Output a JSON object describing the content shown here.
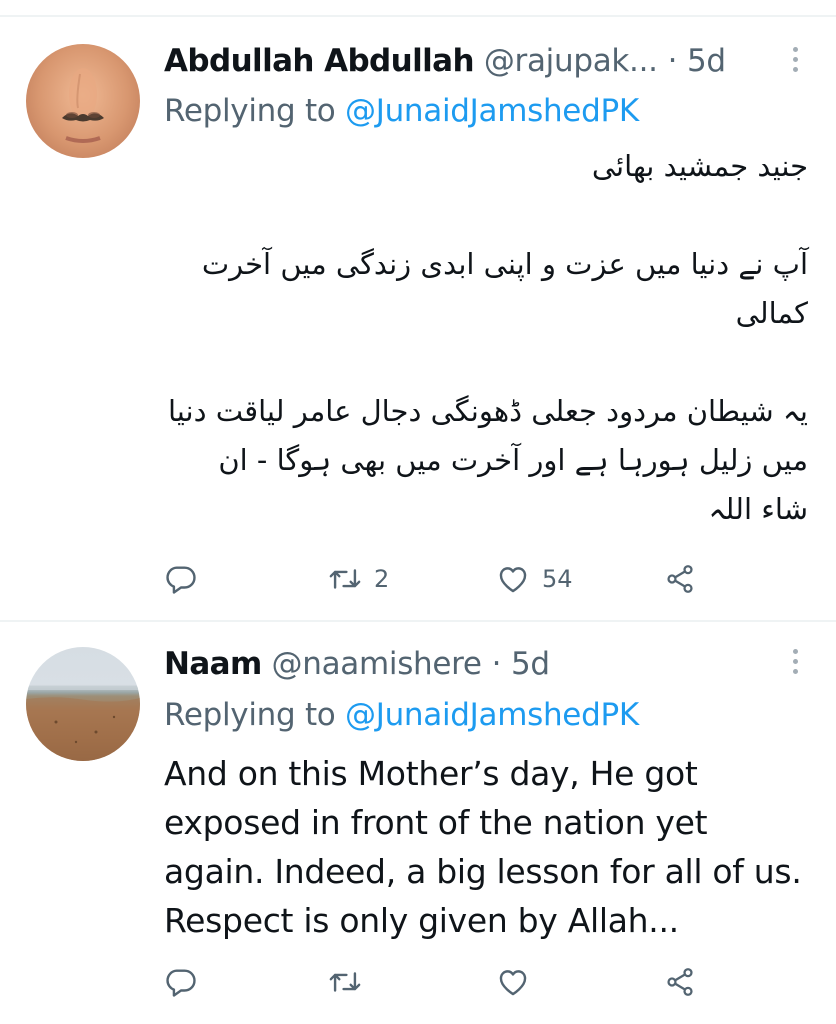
{
  "tweets": [
    {
      "display_name": "Abdullah Abdullah",
      "handle": "@rajupak...",
      "separator": "·",
      "time": "5d",
      "replying_prefix": "Replying to",
      "replying_handle": "@JunaidJamshedPK",
      "body_paragraphs": [
        "جنید جمشید بھائی",
        "آپ نے دنیا میں عزت و اپنی ابدی زندگی میں آخرت کمالی",
        "یہ شیطان مردود جعلی ڈھونگی دجال عامر لیاقت دنیا میں  زلیل ہورہا ہے اور آخرت میں بھی ہوگا - ان شاء اللہ"
      ],
      "avatar": "avatar-face-closeup",
      "actions": {
        "reply_icon": "reply-icon",
        "retweet_icon": "retweet-icon",
        "retweet_count": "2",
        "like_icon": "heart-icon",
        "like_count": "54",
        "share_icon": "share-icon"
      }
    },
    {
      "display_name": "Naam",
      "handle": "@naamishere",
      "separator": "·",
      "time": "5d",
      "replying_prefix": "Replying to",
      "replying_handle": "@JunaidJamshedPK",
      "body_lines": [
        "And on this Mother’s day, He got",
        "exposed in front of the nation yet",
        "again. Indeed, a big lesson for all of us.",
        "Respect is only given by Allah..."
      ],
      "avatar": "avatar-beach",
      "actions": {
        "reply_icon": "reply-icon",
        "retweet_icon": "retweet-icon",
        "retweet_count": "",
        "like_icon": "heart-icon",
        "like_count": "",
        "share_icon": "share-icon"
      }
    }
  ],
  "colors": {
    "text": "#0f1419",
    "secondary": "#536471",
    "link": "#1d9bf0",
    "divider": "#eff3f4"
  }
}
